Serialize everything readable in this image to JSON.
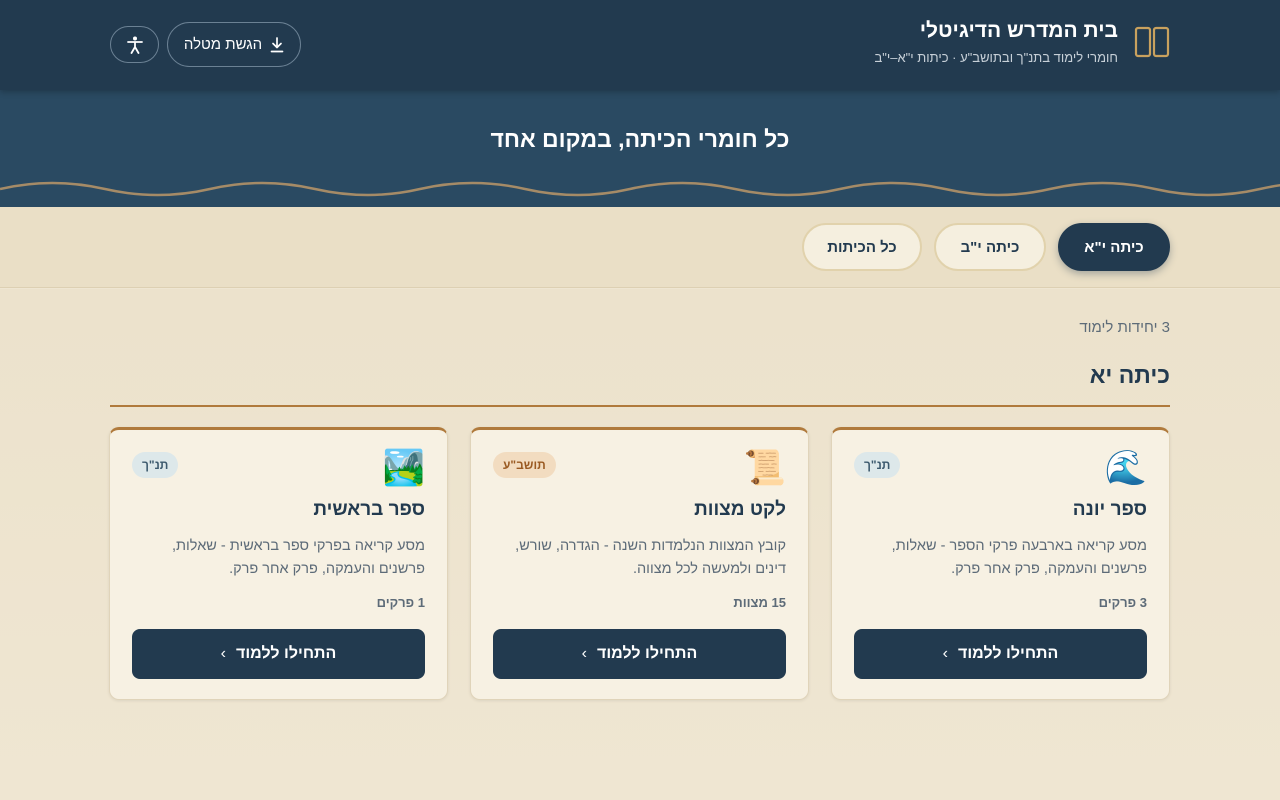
{
  "header": {
    "title": "בית המדרש הדיגיטלי",
    "subtitle": "חומרי לימוד בתנ\"ך ובתושב\"ע · כיתות י\"א–י\"ב",
    "upload_label": "הגשת מטלה",
    "logo_icon": "book-open-icon",
    "accessibility_icon": "accessibility-icon",
    "upload_icon": "download-icon"
  },
  "hero": {
    "title": "כל חומרי הכיתה, במקום אחד"
  },
  "tabs": [
    {
      "label": "כיתה י\"א",
      "active": true
    },
    {
      "label": "כיתה י\"ב",
      "active": false
    },
    {
      "label": "כל הכיתות",
      "active": false
    }
  ],
  "main": {
    "count_text": "3 יחידות לימוד",
    "section_title": "כיתה יא",
    "cards": [
      {
        "emoji": "🌊",
        "badge": "תנ\"ך",
        "title": "ספר יונה",
        "description": "מסע קריאה בארבעה פרקי הספר - שאלות, פרשנים והעמקה, פרק אחר פרק.",
        "meta": "3 פרקים",
        "button": "התחילו ללמוד"
      },
      {
        "emoji": "📜",
        "badge": "תושב\"ע",
        "title": "לקט מצוות",
        "description": "קובץ המצוות הנלמדות השנה - הגדרה, שורש, דינים ולמעשה לכל מצווה.",
        "meta": "15 מצוות",
        "button": "התחילו ללמוד"
      },
      {
        "emoji": "🏞️",
        "badge": "תנ\"ך",
        "title": "ספר בראשית",
        "description": "מסע קריאה בפרקי ספר בראשית - שאלות, פרשנים והעמקה, פרק אחר פרק.",
        "meta": "1 פרקים",
        "button": "התחילו ללמוד"
      }
    ]
  },
  "colors": {
    "navy": "#223a4f",
    "hero": "#2a4a62",
    "gold": "#b07a3c",
    "background": "#efe6d2"
  }
}
